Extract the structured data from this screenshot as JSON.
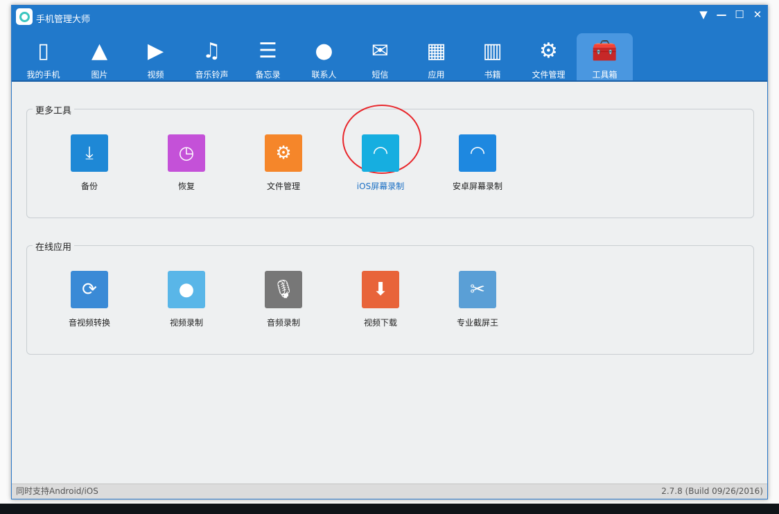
{
  "app": {
    "title": "手机管理大师"
  },
  "window_controls": {
    "menu": "▼",
    "minimize": "—",
    "maximize": "☐",
    "close": "✕"
  },
  "nav": [
    {
      "label": "我的手机",
      "icon": "phone-icon"
    },
    {
      "label": "图片",
      "icon": "image-icon"
    },
    {
      "label": "视频",
      "icon": "video-icon"
    },
    {
      "label": "音乐铃声",
      "icon": "music-icon"
    },
    {
      "label": "备忘录",
      "icon": "memo-icon"
    },
    {
      "label": "联系人",
      "icon": "contact-icon"
    },
    {
      "label": "短信",
      "icon": "mail-icon"
    },
    {
      "label": "应用",
      "icon": "apps-icon"
    },
    {
      "label": "书籍",
      "icon": "book-icon"
    },
    {
      "label": "文件管理",
      "icon": "file-gear-icon"
    },
    {
      "label": "工具箱",
      "icon": "toolbox-icon",
      "active": true
    }
  ],
  "groups": [
    {
      "title": "更多工具",
      "items": [
        {
          "label": "备份",
          "icon": "backup-icon",
          "color": "#1e88d6"
        },
        {
          "label": "恢复",
          "icon": "restore-icon",
          "color": "#c451d8"
        },
        {
          "label": "文件管理",
          "icon": "file-manage-icon",
          "color": "#f5862a"
        },
        {
          "label": "iOS屏幕录制",
          "icon": "ios-screen-record-icon",
          "color": "#16aee0",
          "highlighted": true,
          "text_color": "#1a6fc4"
        },
        {
          "label": "安卓屏幕录制",
          "icon": "android-screen-record-icon",
          "color": "#1e88e0"
        }
      ]
    },
    {
      "title": "在线应用",
      "items": [
        {
          "label": "音视频转换",
          "icon": "av-convert-icon",
          "color": "#3a8ad6"
        },
        {
          "label": "视频录制",
          "icon": "video-record-icon",
          "color": "#59b6e8"
        },
        {
          "label": "音频录制",
          "icon": "microphone-icon",
          "color": "#777777"
        },
        {
          "label": "视频下载",
          "icon": "video-download-icon",
          "color": "#e8643a"
        },
        {
          "label": "专业截屏王",
          "icon": "screenshot-icon",
          "color": "#5a9fd6"
        }
      ]
    }
  ],
  "status": {
    "left": "同时支持Android/iOS",
    "right": "2.7.8 (Build 09/26/2016)"
  }
}
